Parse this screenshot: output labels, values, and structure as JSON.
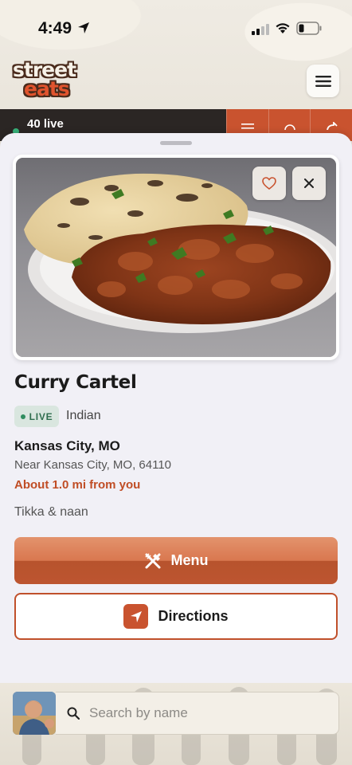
{
  "status_bar": {
    "time": "4:49"
  },
  "app": {
    "logo_line1": "street",
    "logo_line2": "eats"
  },
  "live_strip": {
    "live_count": "40 live"
  },
  "truck": {
    "name": "Curry Cartel",
    "status_badge": "LIVE",
    "cuisine": "Indian",
    "city": "Kansas City, MO",
    "near": "Near Kansas City, MO, 64110",
    "distance": "About 1.0 mi from you",
    "description": "Tikka & naan"
  },
  "actions": {
    "menu_label": "Menu",
    "directions_label": "Directions"
  },
  "search": {
    "placeholder": "Search by name"
  },
  "colors": {
    "accent": "#c9532f",
    "live_green": "#2f8d5f",
    "sheet_bg": "#f1f0f6"
  },
  "icons": {
    "menu": "hamburger-icon",
    "favorite": "heart-icon",
    "close": "close-icon",
    "menu_cta": "fork-knife-icon",
    "directions": "navigation-arrow-icon",
    "search": "search-icon"
  }
}
